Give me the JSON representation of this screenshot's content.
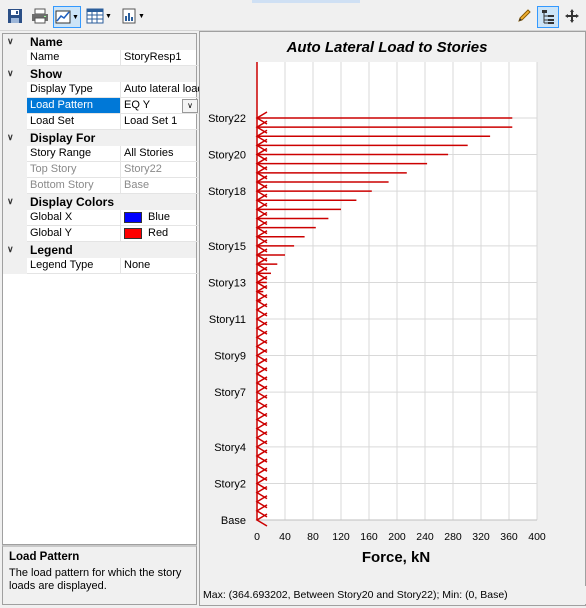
{
  "toolbar": {
    "buttons": [
      "save-icon",
      "print-icon",
      "display-options-icon",
      "table-icon",
      "report-icon"
    ],
    "right_buttons": [
      "pencil-icon",
      "tree-view-icon",
      "move-icon"
    ]
  },
  "property_grid": {
    "categories": {
      "name": "Name",
      "show": "Show",
      "display_for": "Display For",
      "display_colors": "Display Colors",
      "legend": "Legend"
    },
    "rows": {
      "name": {
        "label": "Name",
        "value": "StoryResp1"
      },
      "display_type": {
        "label": "Display Type",
        "value": "Auto lateral load"
      },
      "load_pattern": {
        "label": "Load Pattern",
        "value": "EQ Y"
      },
      "load_set": {
        "label": "Load Set",
        "value": "Load Set 1"
      },
      "story_range": {
        "label": "Story Range",
        "value": "All Stories"
      },
      "top_story": {
        "label": "Top Story",
        "value": "Story22"
      },
      "bottom_story": {
        "label": "Bottom Story",
        "value": "Base"
      },
      "global_x": {
        "label": "Global X",
        "value": "Blue",
        "color": "#0000ff"
      },
      "global_y": {
        "label": "Global Y",
        "value": "Red",
        "color": "#ff0000"
      },
      "legend_type": {
        "label": "Legend Type",
        "value": "None"
      }
    }
  },
  "description": {
    "title": "Load Pattern",
    "text": "The load pattern for which the story loads are displayed."
  },
  "status": {
    "text": "Max: (364.693202, Between Story20 and Story22);   Min: (0, Base)"
  },
  "chart_data": {
    "type": "bar",
    "orientation": "horizontal",
    "title": "Auto Lateral Load to Stories",
    "xlabel": "Force, kN",
    "ylabel": "",
    "xlim": [
      0,
      400
    ],
    "xticks": [
      0,
      40,
      80,
      120,
      160,
      200,
      240,
      280,
      320,
      360,
      400
    ],
    "grid": true,
    "color": "#cc0000",
    "ytick_labels": [
      "Base",
      "Story2",
      "Story4",
      "Story7",
      "Story9",
      "Story11",
      "Story13",
      "Story15",
      "Story18",
      "Story20",
      "Story22"
    ],
    "levels": [
      0,
      2,
      4,
      5.5,
      6.5,
      7.5,
      8.5,
      9.5,
      10.5,
      11.5,
      12.5,
      13.5,
      14.5,
      15.5,
      16.5,
      17.5,
      18.5,
      19.5,
      20.5,
      21.5,
      22.5
    ],
    "values": [
      364.7,
      364.7,
      333,
      301,
      273,
      243,
      214,
      188,
      164,
      142,
      120,
      102,
      84,
      68,
      53,
      40,
      29,
      20,
      14,
      9,
      6,
      3,
      1.5
    ],
    "story_positions": {
      "Base": 0,
      "Story2": 2,
      "Story4": 4,
      "Story7": 7,
      "Story9": 9,
      "Story11": 11,
      "Story13": 13,
      "Story15": 15,
      "Story18": 18,
      "Story20": 20,
      "Story22": 22
    },
    "arrow_levels": [
      22,
      21.5,
      21,
      20.5,
      20,
      19.5,
      19,
      18.5,
      18,
      17.5,
      17,
      16.5,
      16,
      15.5,
      15,
      14.5,
      14,
      13.5,
      13,
      12.5,
      12,
      11.5,
      11,
      10.5,
      10,
      9.5,
      9,
      8.5,
      8,
      7.5,
      7,
      6.5,
      6,
      5.5,
      5,
      4.5,
      4
    ],
    "arrow_values": [
      364.7,
      364.7,
      333,
      301,
      273,
      243,
      214,
      188,
      164,
      142,
      120,
      102,
      84,
      68,
      53,
      40,
      29,
      20,
      14,
      9,
      6,
      3,
      1.5
    ]
  }
}
